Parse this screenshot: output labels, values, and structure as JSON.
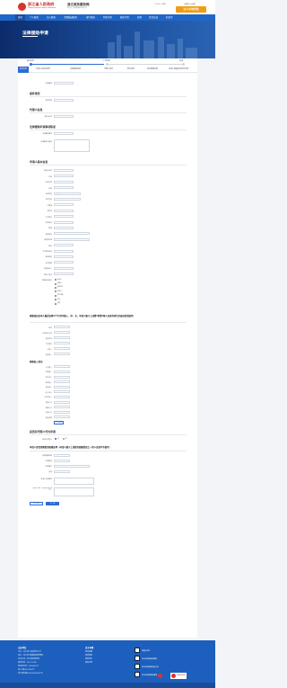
{
  "header": {
    "gov_title": "浙江省人民政府",
    "gov_subtitle": "Zhejiang Provincial People's Government",
    "service_title": "浙江政务服务网",
    "service_subtitle": "浙里办 · 政务服务就上浙里办",
    "top_links": [
      "个人中心",
      "退出"
    ],
    "top_links2": [
      "无障碍",
      "长者版"
    ],
    "action_button": "法人本地导航"
  },
  "nav": [
    "首页",
    "个人服务",
    "法人服务",
    "主题集成服务",
    "部门服务",
    "特色专区",
    "服务专区",
    "其他",
    "互动交流",
    "好差评"
  ],
  "page_title": "法律援助申请",
  "steps": [
    "填写信息",
    "上传材料",
    "完成"
  ],
  "form_tabs": [
    "基本信息",
    "申请人信息及身份",
    "法律援助事项",
    "代理人信息",
    "附件材料",
    "经济困难证明",
    "申请人家庭经济状况声明"
  ],
  "blocks": {
    "apply_field_label": "申请事项",
    "case_type_title": "案件类型",
    "case_type_label": "案件类型",
    "agent_title": "代理人信息",
    "agent_label": "代理人姓名",
    "statement_title": "法律援助申请事项陈述",
    "statement_labels": [
      "法律援助事项",
      "申请事实与理由"
    ],
    "applicant_title": "申请人基本信息",
    "applicant_labels": [
      "申请人姓名",
      "性别",
      "出生日期",
      "民族",
      "证件类型",
      "证件号码",
      "户籍地",
      "住所地",
      "工作单位",
      "联系电话",
      "邮编",
      "通讯地址",
      "经常居住地",
      "职业",
      "工作单位地址",
      "邮政编码",
      "电子邮箱",
      "其他联系人",
      "联系人电话"
    ],
    "applicant_values": [
      "",
      "男",
      "1987-09-08",
      "汉族",
      "居民身份证",
      "3 *** ***** *** **",
      "",
      "",
      "",
      "",
      "",
      "",
      "",
      "",
      "",
      "",
      "",
      "",
      ""
    ],
    "special_title": "特殊群体/身份",
    "special_options": [
      "老年人",
      "残疾人",
      "未成年人",
      "农民工",
      "军人军属",
      "妇女",
      "其他"
    ],
    "family_title": "家庭成员及本人最近连续12个月月均收入（中、女、申请人属于上述第1至第4项人员或共同生活成员的请填写）",
    "family_labels": [
      "姓名",
      "与申请人关系",
      "身份证号",
      "工作单位",
      "月收入",
      "其他收入"
    ],
    "family_values": [
      "",
      "",
      "",
      "",
      "",
      ""
    ],
    "income_title": "家庭收入情况",
    "income_labels": [
      "工资收入",
      "经营收入",
      "财产收入",
      "转移收入",
      "其他收入",
      "收入合计",
      "人均月收入",
      "家庭人口",
      "赡养人口",
      "抚养人口",
      "其他说明"
    ],
    "add_member_button": "+ 添加成员",
    "agent2_title": "是否有代理人代为申请",
    "agent2_label": "是否有代理人",
    "choice_yes": "是",
    "choice_no": "否",
    "assist_title": "申请人是否需要经济困难证明（申请人属于上述经济困难情形之一的人员请不予填写）",
    "assist_labels": [
      "是否需要证明",
      "证明类型",
      "证明单位",
      "其他"
    ],
    "confirm_labels": [
      "申请人承诺事项",
      "承诺人签名（申请人确认签字）"
    ],
    "buttons": [
      "保存草稿",
      "下一步"
    ]
  },
  "footer": {
    "col1_title": "主办单位",
    "col1_lines": [
      "主办：浙江省人民政府办公厅",
      "承办：浙江省大数据发展管理局",
      "技术支持：浙江政务服务网",
      "联系电话：0571-12345",
      "网站标识码：3300000079",
      "浙ICP备05013567号",
      "浙公网安备33010302000019号"
    ],
    "col2_title": "关于本网",
    "col2_lines": [
      "网站地图",
      "使用帮助",
      "联系我们",
      "隐私声明"
    ],
    "qr_labels": [
      "浙里办APP",
      "浙江政务服务网微信",
      "浙江政务服务网支付宝",
      "浙江政务服务网微博"
    ],
    "badge_text": "政府网站找错"
  },
  "colors": {
    "primary": "#1f66c9",
    "accent": "#f39c12",
    "brand_red": "#c62828",
    "footer": "#1d5fbd"
  }
}
